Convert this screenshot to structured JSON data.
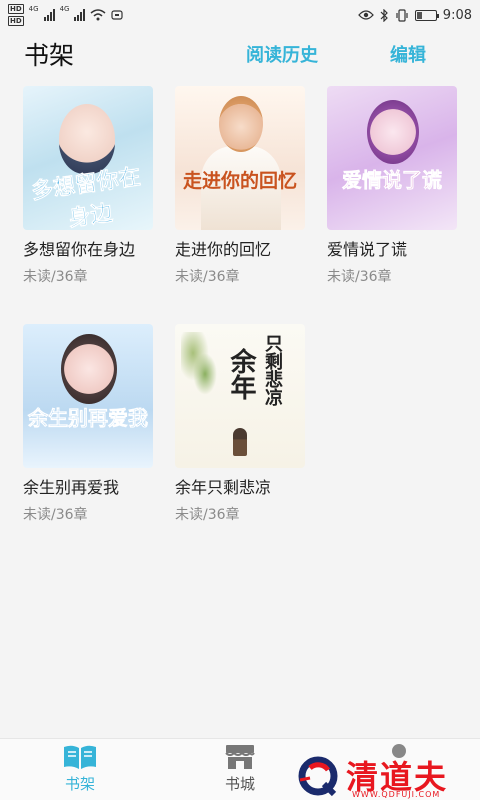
{
  "status_bar": {
    "hd_1": "HD",
    "hd_2": "HD",
    "net_1": "4G",
    "net_2": "4G",
    "time": "9:08"
  },
  "header": {
    "title": "书架",
    "history_label": "阅读历史",
    "edit_label": "编辑"
  },
  "books": [
    {
      "title": "多想留你在身边",
      "cover_title": "多想留你在身边",
      "status": "未读/36章"
    },
    {
      "title": "走进你的回忆",
      "cover_title": "走进你的回忆",
      "status": "未读/36章"
    },
    {
      "title": "爱情说了谎",
      "cover_title": "爱情说了谎",
      "status": "未读/36章"
    },
    {
      "title": "余生别再爱我",
      "cover_title": "余生别再爱我",
      "status": "未读/36章"
    },
    {
      "title": "余年只剩悲凉",
      "cover_title_1": "余年",
      "cover_title_2": "只剩悲凉",
      "status": "未读/36章"
    }
  ],
  "bottom_nav": {
    "shelf_label": "书架",
    "store_label": "书城",
    "shelf_icon": "book-open-icon",
    "store_icon": "store-icon",
    "active_color": "#36b4d8"
  },
  "watermark": {
    "text": "清道夫",
    "url": "WWW.QDFUJI.COM"
  },
  "colors": {
    "accent": "#36b4d8",
    "background": "#f4f4f4",
    "watermark": "#e8171f"
  }
}
